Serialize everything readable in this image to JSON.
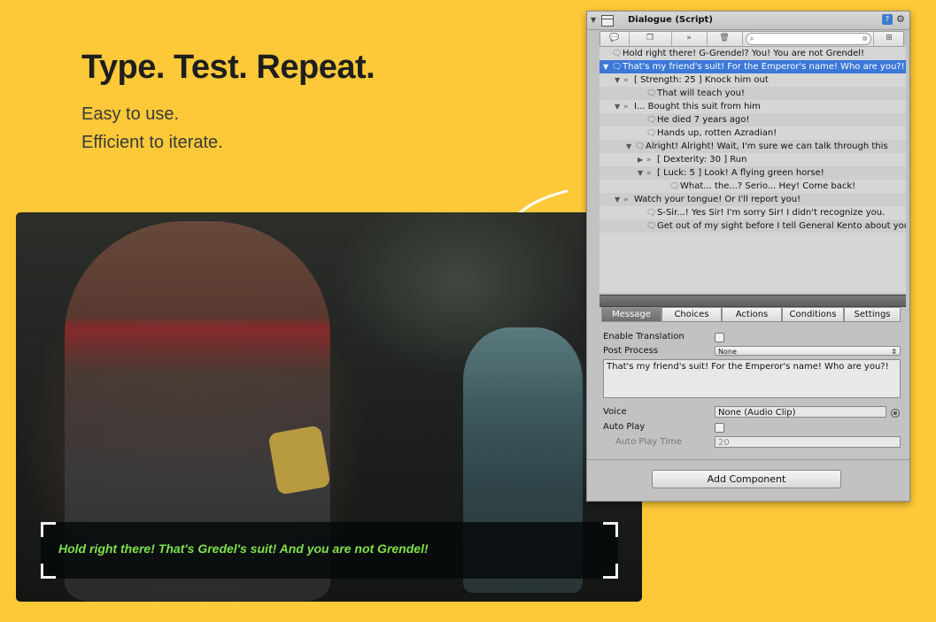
{
  "hero": {
    "headline": "Type. Test. Repeat.",
    "line1": "Easy to use.",
    "line2": "Efficient to iterate."
  },
  "game": {
    "subtitle": "Hold right there! That's Gredel's suit! And you are not Grendel!",
    "subtitle_color": "#7de24a"
  },
  "inspector": {
    "title": "Dialogue (Script)",
    "help_glyph": "?",
    "gear_glyph": "⚙",
    "toolbar": {
      "icons": [
        "speech-icon",
        "copy-icon",
        "choice-icon",
        "trash-icon",
        "search-icon",
        "expand-icon"
      ]
    },
    "tree": [
      {
        "indent": 0,
        "fold": "",
        "icon": "speech",
        "text": "Hold right there! G-Grendel? You! You are not Grendel!"
      },
      {
        "indent": 0,
        "fold": "▼",
        "icon": "speech",
        "text": "That's my friend's suit! For the Emperor's name! Who are you?!",
        "selected": true
      },
      {
        "indent": 1,
        "fold": "▼",
        "icon": "choice",
        "text": "[ Strength: 25 ] Knock him out"
      },
      {
        "indent": 3,
        "fold": "",
        "icon": "speech",
        "text": "That will teach you!"
      },
      {
        "indent": 1,
        "fold": "▼",
        "icon": "choice",
        "text": "I... Bought this suit from him"
      },
      {
        "indent": 3,
        "fold": "",
        "icon": "speech",
        "text": "He died 7 years ago!"
      },
      {
        "indent": 3,
        "fold": "",
        "icon": "speech",
        "text": "Hands up, rotten Azradian!"
      },
      {
        "indent": 2,
        "fold": "▼",
        "icon": "speech",
        "text": "Alright! Alright! Wait, I'm sure we can talk through this"
      },
      {
        "indent": 3,
        "fold": "▶",
        "icon": "choice",
        "text": "[ Dexterity: 30 ] Run"
      },
      {
        "indent": 3,
        "fold": "▼",
        "icon": "choice",
        "text": "[ Luck: 5 ] Look! A flying green horse!"
      },
      {
        "indent": 5,
        "fold": "",
        "icon": "speech",
        "text": "What... the...? Serio... Hey! Come back!"
      },
      {
        "indent": 1,
        "fold": "▼",
        "icon": "choice",
        "text": "Watch your tongue! Or I'll report you!"
      },
      {
        "indent": 3,
        "fold": "",
        "icon": "speech",
        "text": "S-Sir...! Yes Sir! I'm sorry Sir! I didn't recognize you."
      },
      {
        "indent": 3,
        "fold": "",
        "icon": "speech",
        "text": "Get out of my sight before I tell General Kento about you!"
      }
    ],
    "tabs": [
      {
        "label": "Message",
        "active": true
      },
      {
        "label": "Choices"
      },
      {
        "label": "Actions"
      },
      {
        "label": "Conditions"
      },
      {
        "label": "Settings"
      }
    ],
    "props": {
      "enable_translation_label": "Enable Translation",
      "post_process_label": "Post Process",
      "post_process_value": "None",
      "message_text": "That's my friend's suit! For the Emperor's name! Who are you?!",
      "voice_label": "Voice",
      "voice_value": "None (Audio Clip)",
      "auto_play_label": "Auto Play",
      "auto_play_time_label": "Auto Play Time",
      "auto_play_time_value": "20"
    },
    "add_component_label": "Add Component"
  }
}
